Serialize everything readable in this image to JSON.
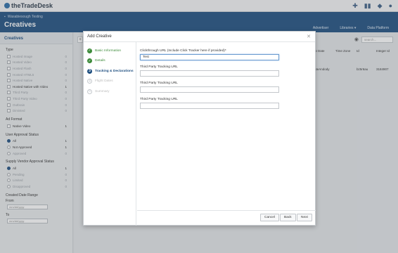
{
  "app": {
    "logo_text": "theTradeDesk"
  },
  "topbar": {
    "icons": [
      "plus-icon",
      "chart-icon",
      "handshake-icon",
      "user-icon"
    ]
  },
  "header": {
    "breadcrumb": "Wasabiesough Testing",
    "title": "Creatives",
    "nav": {
      "advertiser": "Advertiser",
      "libraries": "Libraries ▾",
      "data_platform": "Data Platform"
    }
  },
  "sidebar": {
    "title": "Creatives",
    "type": {
      "title": "Type",
      "items": [
        {
          "label": "Hosted Image",
          "count": "0"
        },
        {
          "label": "Hosted Video",
          "count": "0"
        },
        {
          "label": "Hosted Flash",
          "count": "0"
        },
        {
          "label": "Hosted HTML5",
          "count": "0"
        },
        {
          "label": "Hosted Native",
          "count": "0"
        },
        {
          "label": "Hosted Native with Video",
          "count": "1"
        },
        {
          "label": "Third Party",
          "count": "0"
        },
        {
          "label": "Third Party Video",
          "count": "0"
        },
        {
          "label": "Outbrain",
          "count": "0"
        },
        {
          "label": "Dimisted",
          "count": "0"
        }
      ]
    },
    "ad_format": {
      "title": "Ad Format",
      "items": [
        {
          "label": "Native Video",
          "count": "1"
        }
      ]
    },
    "user_approval": {
      "title": "User Approval Status",
      "items": [
        {
          "label": "All",
          "count": "1"
        },
        {
          "label": "Not Approved",
          "count": "1"
        },
        {
          "label": "Approved",
          "count": "0"
        }
      ]
    },
    "supply_approval": {
      "title": "Supply Vendor Approval Status",
      "items": [
        {
          "label": "All",
          "count": "1"
        },
        {
          "label": "Pending",
          "count": "0"
        },
        {
          "label": "Limited",
          "count": "0"
        },
        {
          "label": "Disapproved",
          "count": "0"
        }
      ]
    },
    "date_range": {
      "title": "Created Date Range",
      "from_label": "From",
      "to_label": "To",
      "from_placeholder": "mm/dd/yyyy",
      "to_placeholder": "mm/dd/yyyy"
    }
  },
  "background": {
    "search_placeholder": "search...",
    "headers": {
      "start_date": "nt Date",
      "time_zone": "Time Zone",
      "id": "Id",
      "integer_id": "Integer Id"
    },
    "row": {
      "start_date": "ateAndody",
      "id": "bz5r6au",
      "integer_id": "3184907"
    }
  },
  "modal": {
    "title": "Add Creative",
    "steps": [
      {
        "label": "Basic Information",
        "state": "done",
        "icon": "✓"
      },
      {
        "label": "Details",
        "state": "done",
        "icon": "✓"
      },
      {
        "label": "Tracking & Declarations",
        "state": "current",
        "icon": "3"
      },
      {
        "label": "Flight Dates",
        "state": "todo",
        "icon": "4"
      },
      {
        "label": "Summary",
        "state": "todo",
        "icon": "5"
      }
    ],
    "fields": [
      {
        "label": "Clickthrough URL (Include Click Tracker here if provided)*",
        "value": "Test"
      },
      {
        "label": "Third Party Tracking URL",
        "value": ""
      },
      {
        "label": "Third Party Tracking URL",
        "value": ""
      },
      {
        "label": "Third Party Tracking URL",
        "value": ""
      }
    ],
    "buttons": {
      "cancel": "Cancel",
      "back": "Back",
      "next": "Next"
    }
  }
}
